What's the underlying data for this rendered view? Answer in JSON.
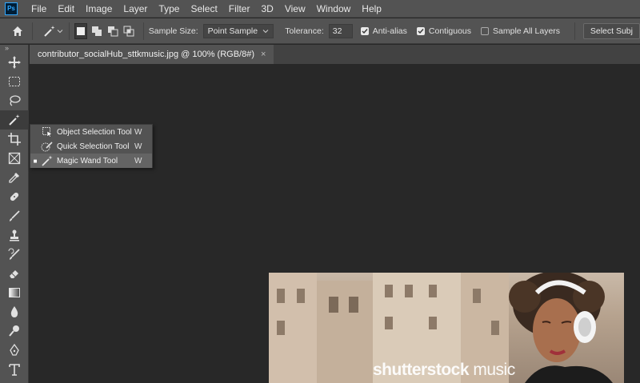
{
  "menubar": {
    "logo": "Ps",
    "items": [
      "File",
      "Edit",
      "Image",
      "Layer",
      "Type",
      "Select",
      "Filter",
      "3D",
      "View",
      "Window",
      "Help"
    ]
  },
  "options": {
    "sample_size_label": "Sample Size:",
    "sample_size_value": "Point Sample",
    "tolerance_label": "Tolerance:",
    "tolerance_value": "32",
    "anti_alias_label": "Anti-alias",
    "anti_alias_checked": true,
    "contiguous_label": "Contiguous",
    "contiguous_checked": true,
    "sample_all_label": "Sample All Layers",
    "sample_all_checked": false,
    "select_subject_label": "Select Subj"
  },
  "document": {
    "tab_title": "contributor_socialHub_sttkmusic.jpg @ 100% (RGB/8#)",
    "close_glyph": "×"
  },
  "flyout": {
    "items": [
      {
        "label": "Object Selection Tool",
        "key": "W",
        "selected": false
      },
      {
        "label": "Quick Selection Tool",
        "key": "W",
        "selected": false
      },
      {
        "label": "Magic Wand Tool",
        "key": "W",
        "selected": true
      }
    ]
  },
  "image": {
    "watermark_bold": "shutterstock",
    "watermark_light": " music"
  },
  "toolbar": {
    "grip": "»",
    "tools": [
      "move-tool",
      "marquee-tool",
      "lasso-tool",
      "magic-wand-tool",
      "crop-tool",
      "frame-tool",
      "eyedropper-tool",
      "healing-brush-tool",
      "brush-tool",
      "clone-stamp-tool",
      "history-brush-tool",
      "eraser-tool",
      "gradient-tool",
      "blur-tool",
      "dodge-tool",
      "pen-tool",
      "type-tool"
    ]
  }
}
